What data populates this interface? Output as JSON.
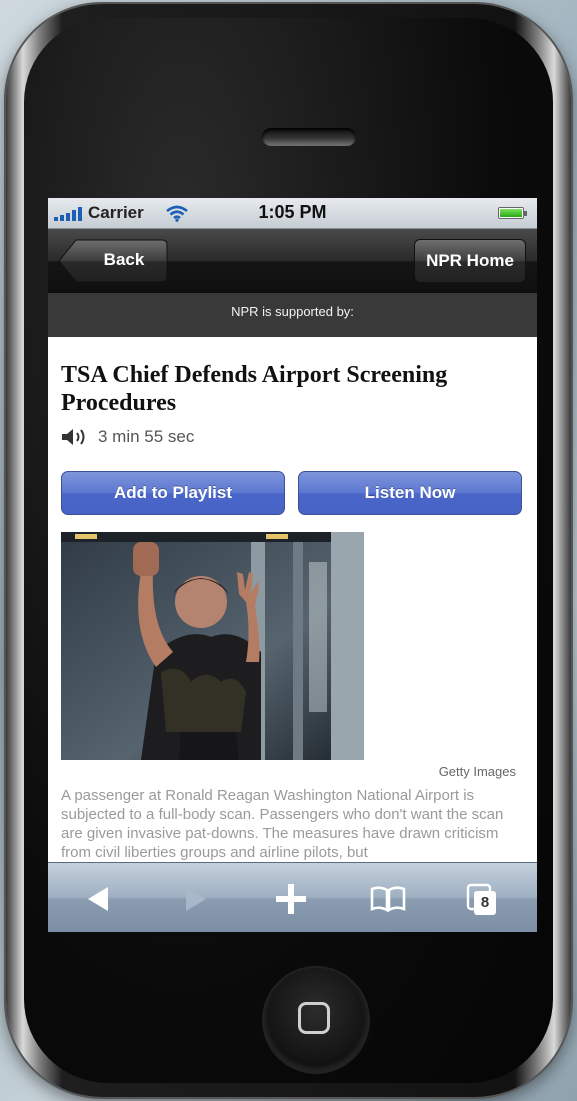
{
  "status_bar": {
    "carrier": "Carrier",
    "time": "1:05 PM"
  },
  "nav_bar": {
    "back_label": "Back",
    "home_label": "NPR Home"
  },
  "sponsor": {
    "text": "NPR is supported by:"
  },
  "article": {
    "headline": "TSA Chief Defends Airport Screening Procedures",
    "duration": "3 min 55 sec",
    "add_to_playlist_label": "Add to Playlist",
    "listen_now_label": "Listen Now",
    "photo_credit": "Getty Images",
    "caption": "A passenger at Ronald Reagan Washington National Airport is subjected to a full-body scan. Passengers who don't want the scan are given invasive pat-downs. The measures have drawn criticism from civil liberties groups and airline pilots, but"
  },
  "toolbar": {
    "tabs_count": "8"
  },
  "colors": {
    "button_blue": "#4a66c8",
    "nav_bar_dark": "#1a1a1a",
    "sponsor_bar": "#393939",
    "toolbar_blue": "#8a9cb0"
  },
  "icons": [
    "wifi-icon",
    "battery-icon",
    "speaker-icon",
    "back-arrow-icon",
    "forward-arrow-icon",
    "add-icon",
    "bookmarks-icon",
    "pages-icon"
  ]
}
